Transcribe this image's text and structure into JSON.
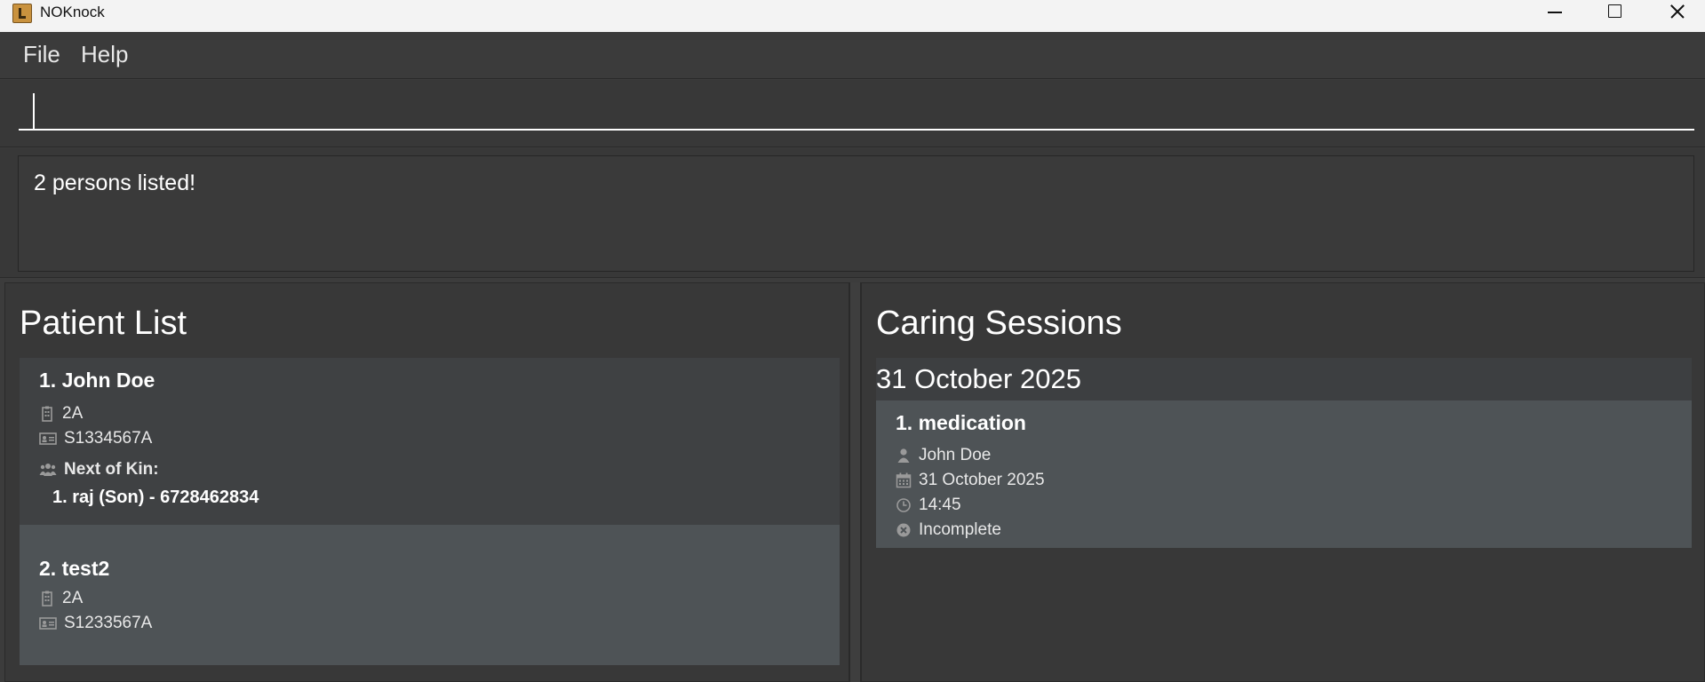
{
  "window": {
    "title": "NOKnock"
  },
  "menu": {
    "file": "File",
    "help": "Help"
  },
  "command": {
    "value": "",
    "placeholder": ""
  },
  "result": {
    "message": "2 persons listed!"
  },
  "patient_list": {
    "title": "Patient List",
    "patients": [
      {
        "name": "1. John Doe",
        "ward": "2A",
        "ic": "S1334567A",
        "next_of_kin_label": "Next of Kin:",
        "next_of_kin": [
          "1. raj (Son) - 6728462834"
        ]
      },
      {
        "name": "2. test2",
        "ward": "2A",
        "ic": "S1233567A"
      }
    ]
  },
  "caring_sessions": {
    "title": "Caring Sessions",
    "groups": [
      {
        "date": "31 October 2025",
        "sessions": [
          {
            "name": "1. medication",
            "patient": "John Doe",
            "date": "31 October 2025",
            "time": "14:45",
            "status": "Incomplete"
          }
        ]
      }
    ]
  },
  "colors": {
    "background": "#3c3c3c",
    "card_dark": "#3f4143",
    "card_light": "#4e5356",
    "text": "#ffffff",
    "icon": "#9a9a9a"
  }
}
